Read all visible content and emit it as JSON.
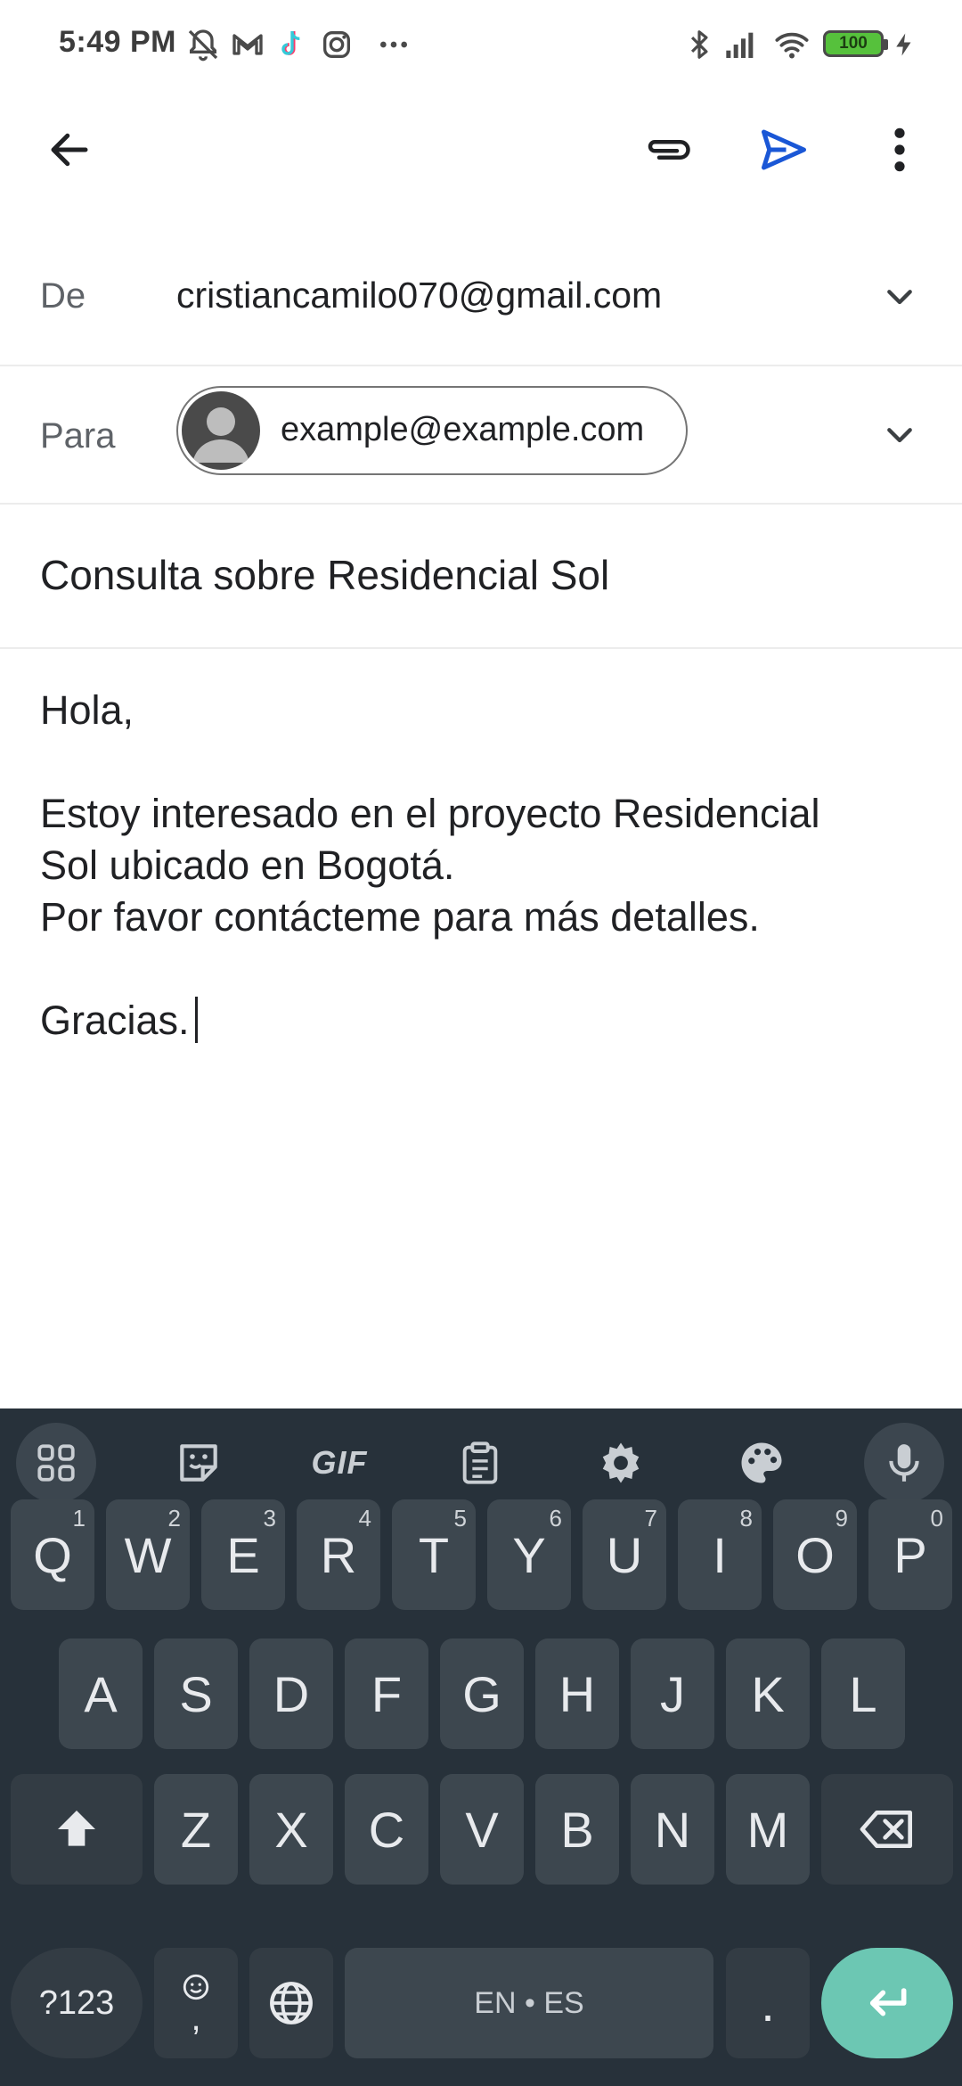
{
  "status_bar": {
    "time": "5:49 PM",
    "battery": "100",
    "icons": [
      "dnd-off-icon",
      "gmail-icon",
      "tiktok-icon",
      "instagram-icon",
      "more-icon",
      "bluetooth-icon",
      "signal-icon",
      "wifi-icon",
      "battery-icon",
      "charging-icon"
    ]
  },
  "app_bar": {
    "icons": [
      "back-arrow-icon",
      "attach-icon",
      "send-icon",
      "overflow-menu-icon"
    ],
    "accent": "#1a57d6"
  },
  "compose": {
    "from_label": "De",
    "from_value": "cristiancamilo070@gmail.com",
    "to_label": "Para",
    "to_chip": "example@example.com",
    "subject": "Consulta sobre Residencial Sol",
    "body_lines": [
      "Hola,",
      "",
      "Estoy interesado en el proyecto Residencial",
      "Sol ubicado en Bogotá.",
      "Por favor contácteme para más detalles.",
      "",
      "Gracias."
    ]
  },
  "keyboard": {
    "toolbar": {
      "gif_label": "GIF",
      "icons": [
        "apps-grid-icon",
        "sticker-icon",
        "gif-icon",
        "clipboard-icon",
        "settings-icon",
        "palette-icon",
        "microphone-icon"
      ]
    },
    "row1": [
      {
        "label": "Q",
        "hint": "1"
      },
      {
        "label": "W",
        "hint": "2"
      },
      {
        "label": "E",
        "hint": "3"
      },
      {
        "label": "R",
        "hint": "4"
      },
      {
        "label": "T",
        "hint": "5"
      },
      {
        "label": "Y",
        "hint": "6"
      },
      {
        "label": "U",
        "hint": "7"
      },
      {
        "label": "I",
        "hint": "8"
      },
      {
        "label": "O",
        "hint": "9"
      },
      {
        "label": "P",
        "hint": "0"
      }
    ],
    "row2": [
      "A",
      "S",
      "D",
      "F",
      "G",
      "H",
      "J",
      "K",
      "L"
    ],
    "row3": [
      "Z",
      "X",
      "C",
      "V",
      "B",
      "N",
      "M"
    ],
    "symbols_label": "?123",
    "comma_label": ",",
    "space_label": "EN • ES",
    "period_label": ".",
    "enter_color": "#6cc7b3",
    "background": "#27313a"
  }
}
